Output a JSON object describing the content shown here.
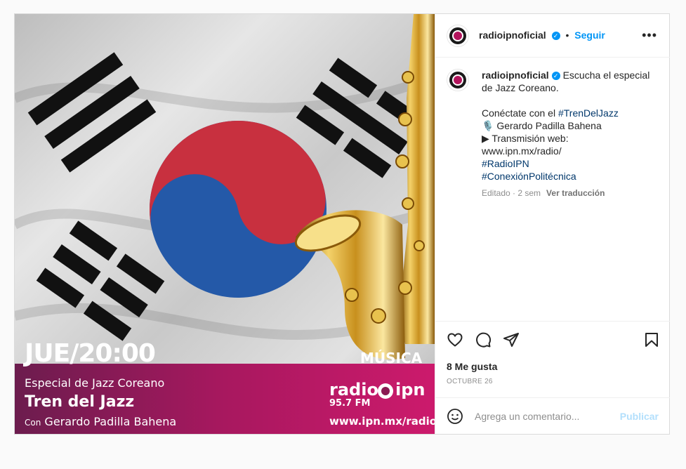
{
  "post": {
    "username": "radioipnoficial",
    "follow_label": "Seguir",
    "more_label": "•••",
    "caption_lines": [
      {
        "text": "Escucha el especial"
      },
      {
        "text": "de Jazz Coreano."
      },
      {
        "text": ""
      },
      {
        "text": "Conéctate con el "
      },
      {
        "text": "🎙️ Gerardo Padilla Bahena"
      },
      {
        "text": "▶ Transmisión web:"
      },
      {
        "text": "www.ipn.mx/radio/"
      }
    ],
    "hashtag_tren": "#TrenDelJazz",
    "hashtags": [
      "#RadioIPN",
      "#ConexiónPolitécnica"
    ],
    "edited_label": "Editado · 2 sem",
    "translate_label": "Ver traducción",
    "likes": "8 Me gusta",
    "date": "OCTUBRE 26",
    "comment_placeholder": "Agrega un comentario...",
    "publish_label": "Publicar"
  },
  "image": {
    "day_time": "JUE/20:00",
    "category": "MÚSICA",
    "subtitle": "Especial de Jazz Coreano",
    "program": "Tren del Jazz",
    "host_prefix": "Con",
    "host": "Gerardo Padilla Bahena",
    "brand_left": "radio",
    "brand_right": "ipn",
    "frequency": "95.7 FM",
    "url": "www.ipn.mx/radio/"
  },
  "colors": {
    "accent": "#0095f6",
    "banner_start": "#6c1c4e",
    "banner_end": "#cc1a6c",
    "flag_red": "#c8303f",
    "flag_blue": "#2459a8"
  },
  "icons": [
    "heart-icon",
    "comment-icon",
    "share-icon",
    "bookmark-icon",
    "emoji-icon",
    "verified-icon",
    "more-icon"
  ]
}
